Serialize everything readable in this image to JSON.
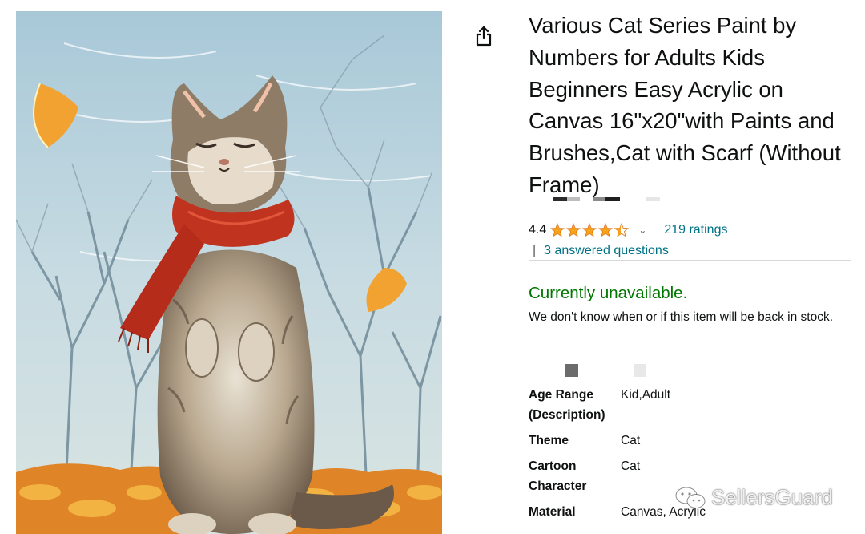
{
  "product": {
    "title": "Various Cat Series Paint by Numbers for Adults Kids Beginners Easy Acrylic on Canvas 16\"x20\"with Paints and Brushes,Cat with Scarf (Without Frame)",
    "image_icon": "cat-with-scarf-painting",
    "share_icon": "share-icon"
  },
  "rating": {
    "value": "4.4",
    "stars": 4.4,
    "ratings_link": "219 ratings",
    "qa_separator": "|",
    "questions_link": "3 answered questions"
  },
  "availability": {
    "status": "Currently unavailable.",
    "note": "We don't know when or if this item will be back in stock."
  },
  "attributes": [
    {
      "label": "Age Range (Description)",
      "value": "Kid,Adult"
    },
    {
      "label": "Theme",
      "value": "Cat"
    },
    {
      "label": "Cartoon Character",
      "value": "Cat"
    },
    {
      "label": "Material",
      "value": "Canvas, Acrylic"
    }
  ],
  "watermark": {
    "text": "SellersGuard",
    "icon": "wechat-icon"
  },
  "colors": {
    "link": "#007185",
    "available_green": "#007600",
    "star": "#f7a41d",
    "text": "#0f1111"
  }
}
